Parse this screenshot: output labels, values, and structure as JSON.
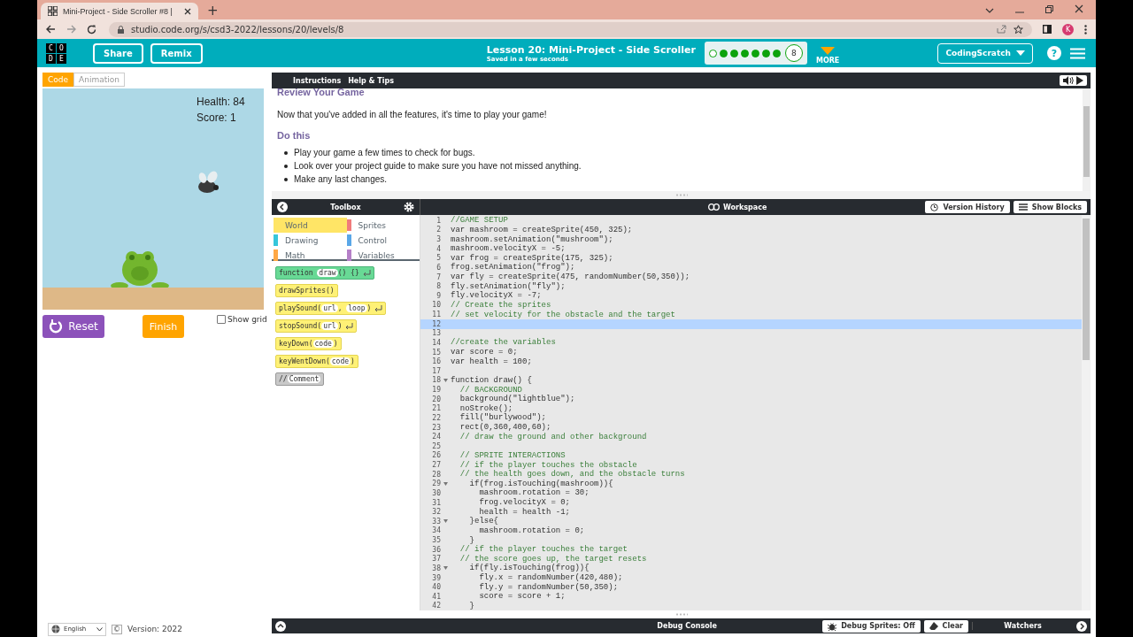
{
  "browser": {
    "tab_title": "Mini-Project - Side Scroller #8 |",
    "new_tab": "+",
    "url": "studio.code.org/s/csd3-2022/lessons/20/levels/8",
    "profile": "K"
  },
  "header": {
    "logo_letters": [
      "C",
      "O",
      "D",
      "E"
    ],
    "buttons": [
      "Share",
      "Remix"
    ],
    "title": "Lesson 20: Mini-Project - Side Scroller",
    "subtitle": "Saved in a few seconds",
    "progress": [
      {
        "completed": false
      },
      {
        "completed": true
      },
      {
        "completed": true
      },
      {
        "completed": true
      },
      {
        "completed": true
      },
      {
        "completed": true
      },
      {
        "completed": true
      }
    ],
    "current_level": "8",
    "more": "MORE",
    "user": "CodingScratch",
    "help": "?"
  },
  "mode_tabs": [
    {
      "label": "Code",
      "selected": true
    },
    {
      "label": "Animation",
      "selected": false
    }
  ],
  "game": {
    "health": "Health: 84",
    "score": "Score: 1"
  },
  "run_buttons": {
    "reset": "Reset",
    "finish": "Finish"
  },
  "show_grid": {
    "label": "Show grid",
    "checked": false
  },
  "footer": {
    "language": "English",
    "copyright": "©",
    "version": "Version: 2022"
  },
  "instructions": {
    "tabs": [
      "Instructions",
      "Help & Tips"
    ],
    "heading": "Review Your Game",
    "intro": "Now that you've added in all the features, it's time to play your game!",
    "subheading": "Do this",
    "bullets": [
      "Play your game a few times to check for bugs.",
      "Look over your project guide to make sure you have not missed anything.",
      "Make any last changes."
    ]
  },
  "toolbox": {
    "title": "Toolbox",
    "categories": [
      {
        "label": "World",
        "color": "#ffe566",
        "selected": true
      },
      {
        "label": "Sprites",
        "color": "#f07c7c",
        "selected": false
      },
      {
        "label": "Drawing",
        "color": "#36c6da",
        "selected": false
      },
      {
        "label": "Control",
        "color": "#5aa7e8",
        "selected": false
      },
      {
        "label": "Math",
        "color": "#ffa845",
        "selected": false
      },
      {
        "label": "Variables",
        "color": "#b580c8",
        "selected": false
      }
    ],
    "blocks": [
      {
        "kind": "function",
        "parts": [
          {
            "text": "function ",
            "pill": false
          },
          {
            "text": "draw",
            "pill": true
          },
          {
            "text": "() {}",
            "pill": false
          }
        ],
        "return": true
      },
      {
        "kind": "statement",
        "parts": [
          {
            "text": "drawSprites()",
            "pill": false
          }
        ],
        "return": false
      },
      {
        "kind": "statement",
        "parts": [
          {
            "text": "playSound(",
            "pill": false
          },
          {
            "text": "url",
            "pill": true
          },
          {
            "text": ", ",
            "pill": false
          },
          {
            "text": "loop",
            "pill": true
          },
          {
            "text": ")",
            "pill": false
          }
        ],
        "return": true
      },
      {
        "kind": "statement",
        "parts": [
          {
            "text": "stopSound(",
            "pill": false
          },
          {
            "text": "url",
            "pill": true
          },
          {
            "text": ")",
            "pill": false
          }
        ],
        "return": true
      },
      {
        "kind": "statement",
        "parts": [
          {
            "text": "keyDown(",
            "pill": false
          },
          {
            "text": "code",
            "pill": true
          },
          {
            "text": ")",
            "pill": false
          }
        ],
        "return": false
      },
      {
        "kind": "statement",
        "parts": [
          {
            "text": "keyWentDown(",
            "pill": false
          },
          {
            "text": "code",
            "pill": true
          },
          {
            "text": ")",
            "pill": false
          }
        ],
        "return": false
      },
      {
        "kind": "comment",
        "parts": [
          {
            "text": "//",
            "pill": false
          },
          {
            "text": "Comment",
            "pill": true
          }
        ],
        "return": false
      }
    ]
  },
  "workspace": {
    "title": "Workspace",
    "version_history": "Version History",
    "show_blocks": "Show Blocks",
    "lines": [
      {
        "n": "1",
        "text": "//GAME SETUP",
        "kind": "comment",
        "active": false,
        "fold": false
      },
      {
        "n": "2",
        "text": "var mashroom = createSprite(450, 325);",
        "kind": "code",
        "active": false,
        "fold": false
      },
      {
        "n": "3",
        "text": "mashroom.setAnimation(\"mushroom\");",
        "kind": "code",
        "active": false,
        "fold": false
      },
      {
        "n": "4",
        "text": "mashroom.velocityX = -5;",
        "kind": "code",
        "active": false,
        "fold": false
      },
      {
        "n": "5",
        "text": "var frog = createSprite(175, 325);",
        "kind": "code",
        "active": false,
        "fold": false
      },
      {
        "n": "6",
        "text": "frog.setAnimation(\"frog\");",
        "kind": "code",
        "active": false,
        "fold": false
      },
      {
        "n": "7",
        "text": "var fly = createSprite(475, randomNumber(50,350));",
        "kind": "code",
        "active": false,
        "fold": false
      },
      {
        "n": "8",
        "text": "fly.setAnimation(\"fly\");",
        "kind": "code",
        "active": false,
        "fold": false
      },
      {
        "n": "9",
        "text": "fly.velocityX = -7;",
        "kind": "code",
        "active": false,
        "fold": false
      },
      {
        "n": "10",
        "text": "// Create the sprites",
        "kind": "comment",
        "active": false,
        "fold": false
      },
      {
        "n": "11",
        "text": "// set velocity for the obstacle and the target",
        "kind": "comment",
        "active": false,
        "fold": false
      },
      {
        "n": "12",
        "active": true,
        "fold": false
      },
      {
        "n": "13",
        "active": false,
        "fold": false
      },
      {
        "n": "14",
        "text": "//create the variables",
        "kind": "comment",
        "active": false,
        "fold": false
      },
      {
        "n": "15",
        "text": "var score = 0;",
        "kind": "code",
        "active": false,
        "fold": false
      },
      {
        "n": "16",
        "text": "var health = 100;",
        "kind": "code",
        "active": false,
        "fold": false
      },
      {
        "n": "17",
        "active": false,
        "fold": false
      },
      {
        "n": "18",
        "text": "function draw() {",
        "kind": "code",
        "active": false,
        "fold": true
      },
      {
        "n": "19",
        "text": "  // BACKGROUND",
        "kind": "comment",
        "active": false,
        "fold": false
      },
      {
        "n": "20",
        "text": "  background(\"lightblue\");",
        "kind": "code",
        "active": false,
        "fold": false
      },
      {
        "n": "21",
        "text": "  noStroke();",
        "kind": "code",
        "active": false,
        "fold": false
      },
      {
        "n": "22",
        "text": "  fill(\"burlywood\");",
        "kind": "code",
        "active": false,
        "fold": false
      },
      {
        "n": "23",
        "text": "  rect(0,360,400,60);",
        "kind": "code",
        "active": false,
        "fold": false
      },
      {
        "n": "24",
        "text": "  // draw the ground and other background",
        "kind": "comment",
        "active": false,
        "fold": false
      },
      {
        "n": "25",
        "active": false,
        "fold": false
      },
      {
        "n": "26",
        "text": "  // SPRITE INTERACTIONS",
        "kind": "comment",
        "active": false,
        "fold": false
      },
      {
        "n": "27",
        "text": "  // if the player touches the obstacle",
        "kind": "comment",
        "active": false,
        "fold": false
      },
      {
        "n": "28",
        "text": "  // the health goes down, and the obstacle turns",
        "kind": "comment",
        "active": false,
        "fold": false
      },
      {
        "n": "29",
        "text": "    if(frog.isTouching(mashroom)){",
        "kind": "code",
        "active": false,
        "fold": true
      },
      {
        "n": "30",
        "text": "      mashroom.rotation = 30;",
        "kind": "code",
        "active": false,
        "fold": false
      },
      {
        "n": "31",
        "text": "      frog.velocityX = 0;",
        "kind": "code",
        "active": false,
        "fold": false
      },
      {
        "n": "32",
        "text": "      health = health -1;",
        "kind": "code",
        "active": false,
        "fold": false
      },
      {
        "n": "33",
        "text": "    }else{",
        "kind": "code",
        "active": false,
        "fold": true
      },
      {
        "n": "34",
        "text": "      mashroom.rotation = 0;",
        "kind": "code",
        "active": false,
        "fold": false
      },
      {
        "n": "35",
        "text": "    }",
        "kind": "code",
        "active": false,
        "fold": false
      },
      {
        "n": "36",
        "text": "  // if the player touches the target",
        "kind": "comment",
        "active": false,
        "fold": false
      },
      {
        "n": "37",
        "text": "  // the score goes up, the target resets",
        "kind": "comment",
        "active": false,
        "fold": false
      },
      {
        "n": "38",
        "text": "    if(fly.isTouching(frog)){",
        "kind": "code",
        "active": false,
        "fold": true
      },
      {
        "n": "39",
        "text": "      fly.x = randomNumber(420,480);",
        "kind": "code",
        "active": false,
        "fold": false
      },
      {
        "n": "40",
        "text": "      fly.y = randomNumber(50,350);",
        "kind": "code",
        "active": false,
        "fold": false
      },
      {
        "n": "41",
        "text": "      score = score + 1;",
        "kind": "code",
        "active": false,
        "fold": false
      },
      {
        "n": "42",
        "text": "    }",
        "kind": "code",
        "active": false,
        "fold": false
      }
    ]
  },
  "console": {
    "title": "Debug Console",
    "debug_sprites": "Debug Sprites: Off",
    "clear": "Clear",
    "watchers": "Watchers"
  }
}
